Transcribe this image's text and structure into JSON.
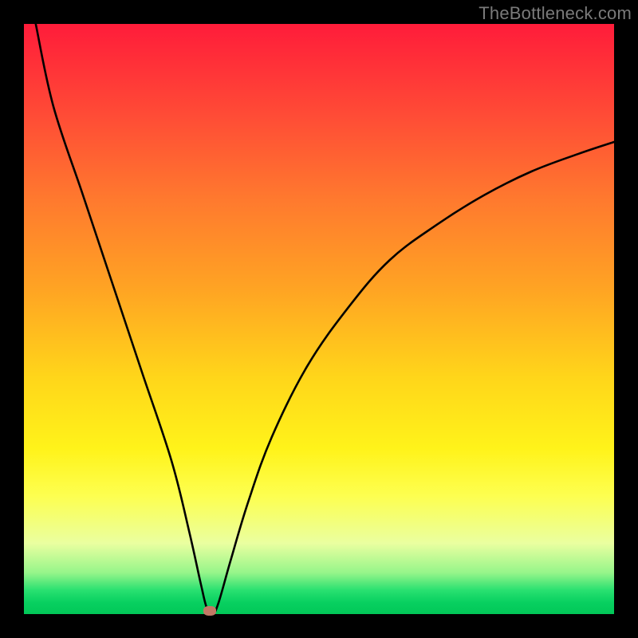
{
  "watermark": "TheBottleneck.com",
  "chart_data": {
    "type": "line",
    "title": "",
    "xlabel": "",
    "ylabel": "",
    "xlim": [
      0,
      100
    ],
    "ylim": [
      0,
      100
    ],
    "grid": false,
    "background_gradient": [
      "#ff1c3a",
      "#ff7a2e",
      "#ffd61a",
      "#fdff50",
      "#28e070",
      "#02c858"
    ],
    "series": [
      {
        "name": "bottleneck-curve",
        "color": "#000000",
        "x": [
          2,
          5,
          10,
          15,
          20,
          25,
          28,
          30,
          31,
          32,
          33,
          35,
          38,
          42,
          48,
          55,
          62,
          70,
          78,
          86,
          94,
          100
        ],
        "values": [
          100,
          86,
          71,
          56,
          41,
          26,
          14,
          5,
          1,
          0,
          2,
          9,
          19,
          30,
          42,
          52,
          60,
          66,
          71,
          75,
          78,
          80
        ]
      }
    ],
    "annotations": [
      {
        "name": "optimal-marker",
        "x": 31.5,
        "y": 0.5,
        "color": "#c27865"
      }
    ]
  }
}
